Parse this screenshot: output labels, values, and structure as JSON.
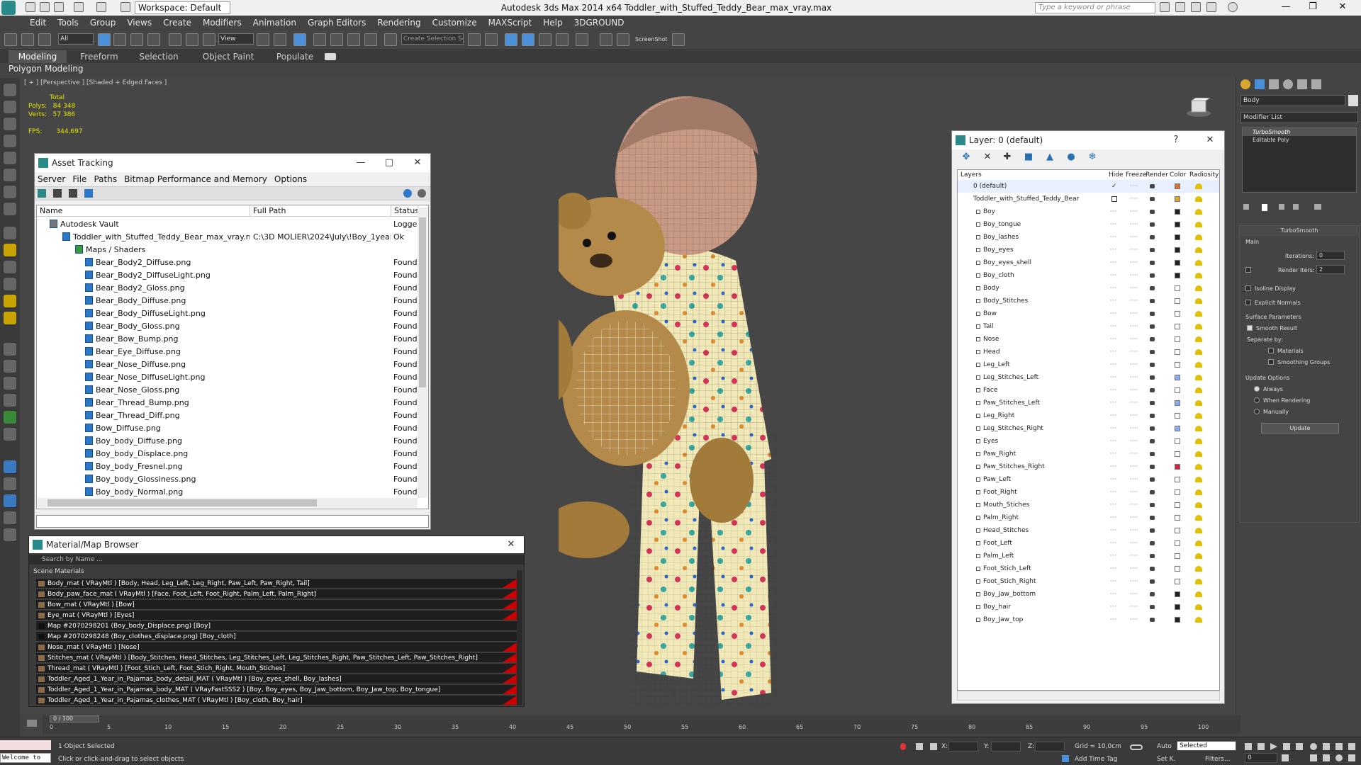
{
  "titlebar": {
    "title": "Autodesk 3ds Max  2014 x64      Toddler_with_Stuffed_Teddy_Bear_max_vray.max",
    "workspace": "Workspace: Default",
    "search_placeholder": "Type a keyword or phrase"
  },
  "menu": [
    "Edit",
    "Tools",
    "Group",
    "Views",
    "Create",
    "Modifiers",
    "Animation",
    "Graph Editors",
    "Rendering",
    "Customize",
    "MAXScript",
    "Help",
    "3DGROUND"
  ],
  "toolbar": {
    "filter_value": "All",
    "refcoord_value": "View",
    "selection_set_placeholder": "Create Selection Se",
    "screenshot_label": "ScreenShot"
  },
  "ribbon": {
    "tabs": [
      "Modeling",
      "Freeform",
      "Selection",
      "Object Paint",
      "Populate"
    ],
    "sub_label": "Polygon Modeling"
  },
  "viewport": {
    "label": "[ + ] [Perspective ] [Shaded + Edged Faces ]",
    "stats_total": "Total",
    "polys_label": "Polys:",
    "polys_value": "84 348",
    "verts_label": "Verts:",
    "verts_value": "57 386",
    "fps_label": "FPS:",
    "fps_value": "344,697"
  },
  "asset_tracking": {
    "title": "Asset Tracking",
    "menus": [
      "Server",
      "File",
      "Paths",
      "Bitmap Performance and Memory",
      "Options"
    ],
    "columns": [
      "Name",
      "Full Path",
      "Status"
    ],
    "rows": [
      {
        "name": "Autodesk Vault",
        "path": "",
        "status": "Logge"
      },
      {
        "name": "Toddler_with_Stuffed_Teddy_Bear_max_vray.max",
        "path": "C:\\3D MOLIER\\2024\\July\\!Boy_1year...",
        "status": "Ok"
      },
      {
        "name": "Maps / Shaders",
        "path": "",
        "status": ""
      },
      {
        "name": "Bear_Body2_Diffuse.png",
        "path": "",
        "status": "Found"
      },
      {
        "name": "Bear_Body2_DiffuseLight.png",
        "path": "",
        "status": "Found"
      },
      {
        "name": "Bear_Body2_Gloss.png",
        "path": "",
        "status": "Found"
      },
      {
        "name": "Bear_Body_Diffuse.png",
        "path": "",
        "status": "Found"
      },
      {
        "name": "Bear_Body_DiffuseLight.png",
        "path": "",
        "status": "Found"
      },
      {
        "name": "Bear_Body_Gloss.png",
        "path": "",
        "status": "Found"
      },
      {
        "name": "Bear_Bow_Bump.png",
        "path": "",
        "status": "Found"
      },
      {
        "name": "Bear_Eye_Diffuse.png",
        "path": "",
        "status": "Found"
      },
      {
        "name": "Bear_Nose_Diffuse.png",
        "path": "",
        "status": "Found"
      },
      {
        "name": "Bear_Nose_DiffuseLight.png",
        "path": "",
        "status": "Found"
      },
      {
        "name": "Bear_Nose_Gloss.png",
        "path": "",
        "status": "Found"
      },
      {
        "name": "Bear_Thread_Bump.png",
        "path": "",
        "status": "Found"
      },
      {
        "name": "Bear_Thread_Diff.png",
        "path": "",
        "status": "Found"
      },
      {
        "name": "Bow_Diffuse.png",
        "path": "",
        "status": "Found"
      },
      {
        "name": "Boy_body_Diffuse.png",
        "path": "",
        "status": "Found"
      },
      {
        "name": "Boy_body_Displace.png",
        "path": "",
        "status": "Found"
      },
      {
        "name": "Boy_body_Fresnel.png",
        "path": "",
        "status": "Found"
      },
      {
        "name": "Boy_body_Glossiness.png",
        "path": "",
        "status": "Found"
      },
      {
        "name": "Boy_body_Normal.png",
        "path": "",
        "status": "Found"
      }
    ]
  },
  "material_browser": {
    "title": "Material/Map Browser",
    "search_placeholder": "Search by Name ...",
    "section": "Scene Materials",
    "rows": [
      "Body_mat  ( VRayMtl ) [Body, Head, Leg_Left, Leg_Right, Paw_Left, Paw_Right, Tail]",
      "Body_paw_face_mat  ( VRayMtl ) [Face, Foot_Left, Foot_Right, Palm_Left, Palm_Right]",
      "Bow_mat  ( VRayMtl ) [Bow]",
      "Eye_mat  ( VRayMtl ) [Eyes]",
      "Map #2070298201 (Boy_body_Displace.png) [Boy]",
      "Map #2070298248 (Boy_clothes_displace.png) [Boy_cloth]",
      "Nose_mat  ( VRayMtl ) [Nose]",
      "Stitches_mat  ( VRayMtl ) [Body_Stitches, Head_Stitches, Leg_Stitches_Left, Leg_Stitches_Right, Paw_Stitches_Left, Paw_Stitches_Right]",
      "Thread_mat  ( VRayMtl ) [Foot_Stich_Left, Foot_Stich_Right, Mouth_Stiches]",
      "Toddler_Aged_1_Year_in_Pajamas_body_detail_MAT  ( VRayMtl ) [Boy_eyes_shell, Boy_lashes]",
      "Toddler_Aged_1_Year_in_Pajamas_body_MAT  ( VRayFastSSS2 ) [Boy, Boy_eyes, Boy_Jaw_bottom, Boy_Jaw_top, Boy_tongue]",
      "Toddler_Aged_1_Year_in_Pajamas_clothes_MAT  ( VRayMtl ) [Boy_cloth, Boy_hair]"
    ]
  },
  "layer_manager": {
    "title": "Layer: 0 (default)",
    "help": "?",
    "columns": [
      "Layers",
      "Hide",
      "Freeze",
      "Render",
      "Color",
      "Radiosity"
    ],
    "root_layers": [
      "0 (default)",
      "Toddler_with_Stuffed_Teddy_Bear"
    ],
    "objects": [
      {
        "name": "Boy",
        "color": "#222222"
      },
      {
        "name": "Boy_tongue",
        "color": "#222222"
      },
      {
        "name": "Boy_lashes",
        "color": "#222222"
      },
      {
        "name": "Boy_eyes",
        "color": "#222222"
      },
      {
        "name": "Boy_eyes_shell",
        "color": "#222222"
      },
      {
        "name": "Boy_cloth",
        "color": "#222222"
      },
      {
        "name": "Body",
        "color": "#ffffff"
      },
      {
        "name": "Body_Stitches",
        "color": "#ffffff"
      },
      {
        "name": "Bow",
        "color": "#ffffff"
      },
      {
        "name": "Tail",
        "color": "#ffffff"
      },
      {
        "name": "Nose",
        "color": "#ffffff"
      },
      {
        "name": "Head",
        "color": "#ffffff"
      },
      {
        "name": "Leg_Left",
        "color": "#ffffff"
      },
      {
        "name": "Leg_Stitches_Left",
        "color": "#88aaee"
      },
      {
        "name": "Face",
        "color": "#ffffff"
      },
      {
        "name": "Paw_Stitches_Left",
        "color": "#88aaee"
      },
      {
        "name": "Leg_Right",
        "color": "#ffffff"
      },
      {
        "name": "Leg_Stitches_Right",
        "color": "#88aaee"
      },
      {
        "name": "Eyes",
        "color": "#ffffff"
      },
      {
        "name": "Paw_Right",
        "color": "#ffffff"
      },
      {
        "name": "Paw_Stitches_Right",
        "color": "#cc2244"
      },
      {
        "name": "Paw_Left",
        "color": "#ffffff"
      },
      {
        "name": "Foot_Right",
        "color": "#ffffff"
      },
      {
        "name": "Mouth_Stiches",
        "color": "#ffffff"
      },
      {
        "name": "Palm_Right",
        "color": "#ffffff"
      },
      {
        "name": "Head_Stitches",
        "color": "#ffffff"
      },
      {
        "name": "Foot_Left",
        "color": "#ffffff"
      },
      {
        "name": "Palm_Left",
        "color": "#ffffff"
      },
      {
        "name": "Foot_Stich_Left",
        "color": "#ffffff"
      },
      {
        "name": "Foot_Stich_Right",
        "color": "#ffffff"
      },
      {
        "name": "Boy_Jaw_bottom",
        "color": "#222222"
      },
      {
        "name": "Boy_hair",
        "color": "#222222"
      },
      {
        "name": "Boy_Jaw_top",
        "color": "#222222"
      }
    ]
  },
  "command_panel": {
    "object_name": "Body",
    "modifier_list": "Modifier List",
    "stack": [
      "TurboSmooth",
      "Editable Poly"
    ],
    "turbosmooth": {
      "title": "TurboSmooth",
      "main": "Main",
      "iterations_label": "Iterations:",
      "iterations_value": "0",
      "render_iters_label": "Render Iters:",
      "render_iters_value": "2",
      "isoline": "Isoline Display",
      "explicit": "Explicit Normals",
      "surface": "Surface Parameters",
      "smooth_result": "Smooth Result",
      "separate": "Separate by:",
      "materials": "Materials",
      "smoothing_groups": "Smoothing Groups",
      "update_options": "Update Options",
      "always": "Always",
      "when_rendering": "When Rendering",
      "manually": "Manually",
      "update_btn": "Update"
    }
  },
  "timeline": {
    "frame": "0 / 100",
    "ticks": [
      "0",
      "5",
      "10",
      "15",
      "20",
      "25",
      "30",
      "35",
      "40",
      "45",
      "50",
      "55",
      "60",
      "65",
      "70",
      "75",
      "80",
      "85",
      "90",
      "95",
      "100"
    ]
  },
  "status": {
    "welcome": "Welcome to",
    "selected": "1 Object Selected",
    "hint": "Click or click-and-drag to select objects",
    "x_label": "X:",
    "y_label": "Y:",
    "z_label": "Z:",
    "grid": "Grid = 10,0cm",
    "add_time_tag": "Add Time Tag",
    "auto": "Auto",
    "setk": "Set K.",
    "selected_dd": "Selected",
    "filters": "Filters...",
    "frame_field": "0"
  }
}
